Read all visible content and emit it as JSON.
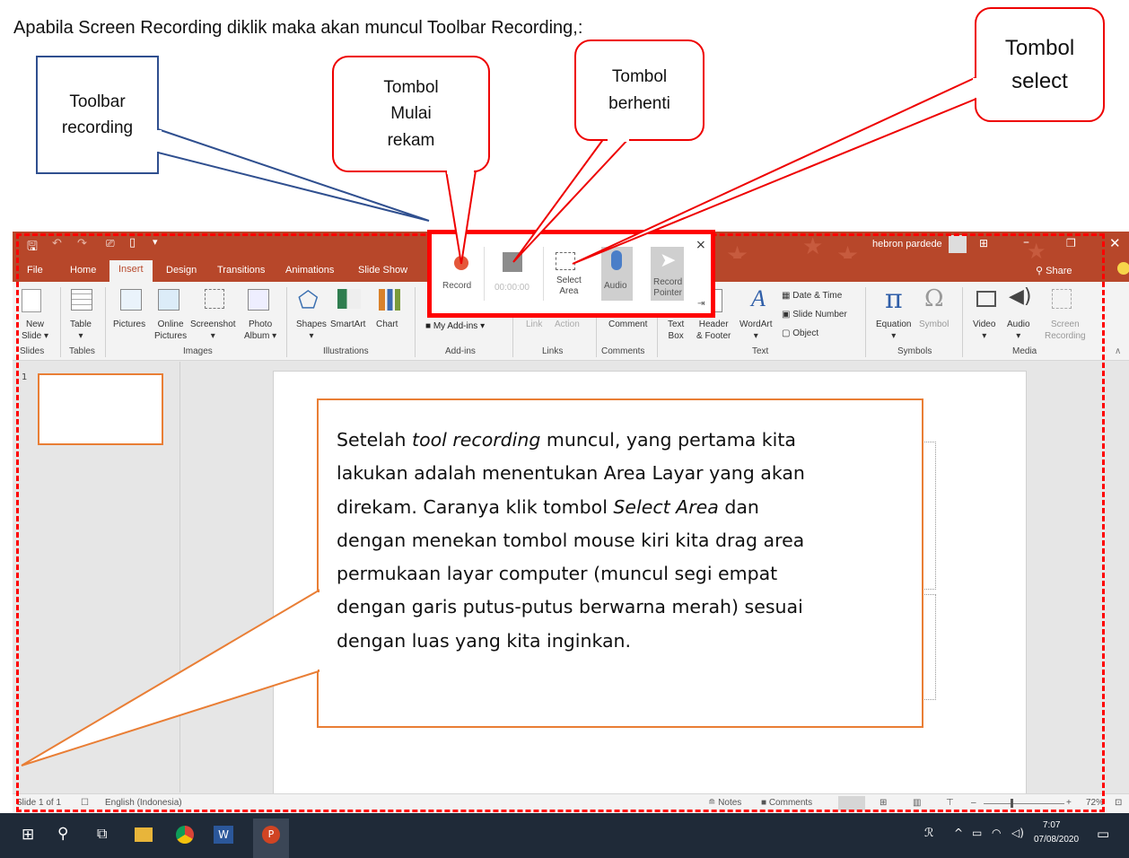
{
  "heading": "Apabila Screen Recording diklik maka akan muncul Toolbar Recording,:",
  "callouts": {
    "toolbar_recording": [
      "Toolbar",
      "recording"
    ],
    "tombol_mulai": [
      "Tombol",
      "Mulai",
      "rekam"
    ],
    "tombol_berhenti": [
      "Tombol",
      "berhenti"
    ],
    "tombol_select": [
      "Tombol",
      "select"
    ]
  },
  "info_box": {
    "line1_pre": "Setelah ",
    "line1_em": "tool recording",
    "line1_post": " muncul, yang pertama kita",
    "line2": "lakukan adalah menentukan Area Layar yang akan",
    "line3_pre": "direkam. Caranya klik tombol ",
    "line3_em": "Select Area",
    "line3_post": " dan",
    "line4": "dengan menekan tombol mouse kiri kita drag area",
    "line5": "permukaan layar computer (muncul segi empat",
    "line6": "dengan garis putus-putus berwarna merah) sesuai",
    "line7": "dengan luas yang kita inginkan."
  },
  "recording_toolbar": {
    "record": "Record",
    "timer": "00:00:00",
    "select_area": [
      "Select",
      "Area"
    ],
    "audio": "Audio",
    "record_pointer": [
      "Record",
      "Pointer"
    ],
    "close": "×"
  },
  "titlebar": {
    "user": "hebron pardede"
  },
  "tabs": [
    "File",
    "Home",
    "Insert",
    "Design",
    "Transitions",
    "Animations",
    "Slide Show"
  ],
  "share": "Share",
  "ribbon": {
    "new_slide": [
      "New",
      "Slide"
    ],
    "table": "Table",
    "pictures": "Pictures",
    "online_pictures": [
      "Online",
      "Pictures"
    ],
    "screenshot": "Screenshot",
    "photo_album": [
      "Photo",
      "Album"
    ],
    "shapes": "Shapes",
    "smartart": "SmartArt",
    "chart": "Chart",
    "my_addins": "My Add-ins",
    "link": "Link",
    "action": "Action",
    "comment": "Comment",
    "text_box": [
      "Text",
      "Box"
    ],
    "header_footer": [
      "Header",
      "& Footer"
    ],
    "wordart": "WordArt",
    "date_time": "Date & Time",
    "slide_number": "Slide Number",
    "object": "Object",
    "equation": "Equation",
    "symbol": "Symbol",
    "video": "Video",
    "audio": "Audio",
    "screen_recording": [
      "Screen",
      "Recording"
    ]
  },
  "groups": [
    "Slides",
    "Tables",
    "Images",
    "Illustrations",
    "Add-ins",
    "Links",
    "Comments",
    "Text",
    "Symbols",
    "Media"
  ],
  "status": {
    "slide": "Slide 1 of 1",
    "language": "English (Indonesia)",
    "notes": "Notes",
    "comments": "Comments",
    "zoom": "72%"
  },
  "thumb_number": "1",
  "taskbar": {
    "time": "7:07",
    "date": "07/08/2020"
  },
  "colors": {
    "accent": "#B7472A",
    "callout_red": "#ff0000",
    "callout_blue": "#2F4F8F",
    "info_border": "#E97E35"
  }
}
